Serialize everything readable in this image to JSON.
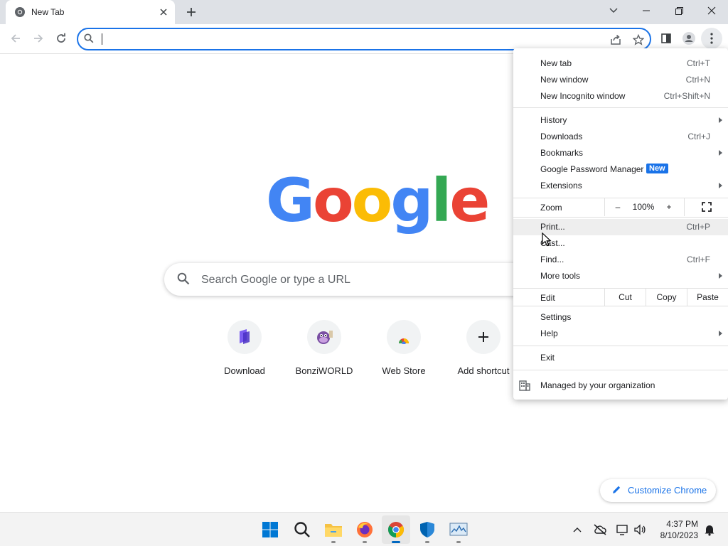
{
  "browser": {
    "tab_title": "New Tab",
    "omnibox": {
      "value": "",
      "placeholder": ""
    }
  },
  "ntp": {
    "logo_letters": [
      "G",
      "o",
      "o",
      "g",
      "l",
      "e"
    ],
    "logo_colors": [
      "#4285f4",
      "#ea4335",
      "#fbbc05",
      "#4285f4",
      "#34a853",
      "#ea4335"
    ],
    "search_placeholder": "Search Google or type a URL",
    "shortcuts": [
      {
        "label": "Download",
        "icon": "download-site-icon"
      },
      {
        "label": "BonziWORLD",
        "icon": "bonziworld-icon"
      },
      {
        "label": "Web Store",
        "icon": "web-store-icon"
      },
      {
        "label": "Add shortcut",
        "icon": "plus-icon"
      }
    ],
    "customize_label": "Customize Chrome"
  },
  "menu": {
    "new_tab": {
      "label": "New tab",
      "shortcut": "Ctrl+T"
    },
    "new_window": {
      "label": "New window",
      "shortcut": "Ctrl+N"
    },
    "new_incognito": {
      "label": "New Incognito window",
      "shortcut": "Ctrl+Shift+N"
    },
    "history": {
      "label": "History"
    },
    "downloads": {
      "label": "Downloads",
      "shortcut": "Ctrl+J"
    },
    "bookmarks": {
      "label": "Bookmarks"
    },
    "password_manager": {
      "label": "Google Password Manager",
      "badge": "New"
    },
    "extensions": {
      "label": "Extensions"
    },
    "zoom": {
      "label": "Zoom",
      "minus": "–",
      "value": "100%",
      "plus": "+"
    },
    "print": {
      "label": "Print...",
      "shortcut": "Ctrl+P"
    },
    "cast": {
      "label": "Cast..."
    },
    "find": {
      "label": "Find...",
      "shortcut": "Ctrl+F"
    },
    "more_tools": {
      "label": "More tools"
    },
    "edit": {
      "label": "Edit",
      "cut": "Cut",
      "copy": "Copy",
      "paste": "Paste"
    },
    "settings": {
      "label": "Settings"
    },
    "help": {
      "label": "Help"
    },
    "exit": {
      "label": "Exit"
    },
    "managed": {
      "label": "Managed by your organization"
    }
  },
  "taskbar": {
    "time": "4:37 PM",
    "date": "8/10/2023"
  },
  "colors": {
    "accent": "#1a73e8",
    "tabstrip": "#dee1e6"
  }
}
